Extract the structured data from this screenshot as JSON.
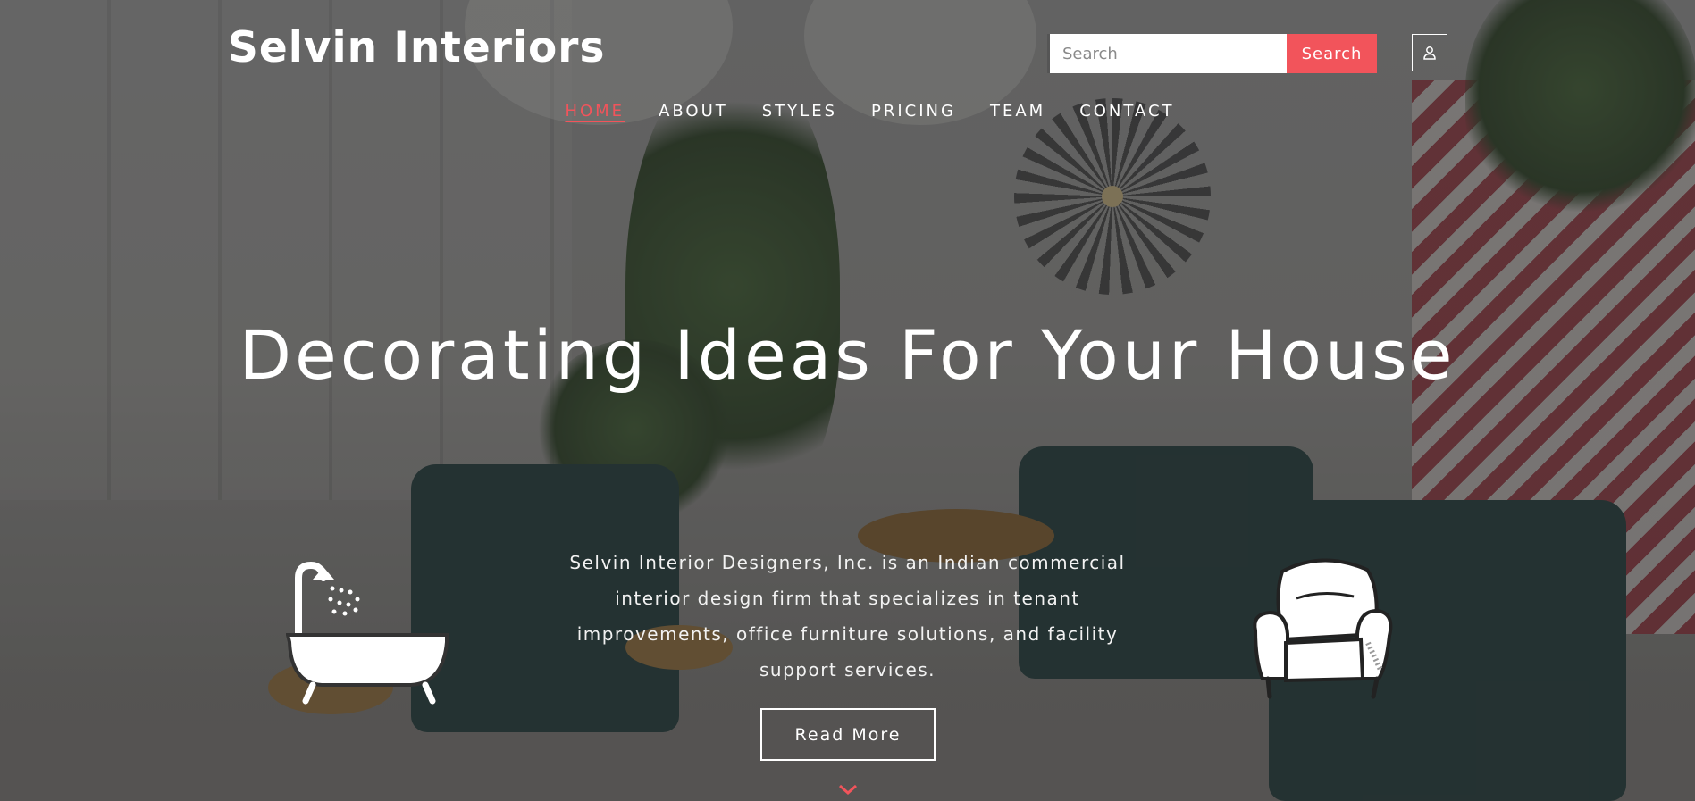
{
  "header": {
    "brand": "Selvin Interiors",
    "search": {
      "placeholder": "Search",
      "button_label": "Search"
    },
    "user_icon": "user-icon"
  },
  "nav": {
    "items": [
      {
        "label": "HOME",
        "active": true
      },
      {
        "label": "ABOUT",
        "active": false
      },
      {
        "label": "STYLES",
        "active": false
      },
      {
        "label": "PRICING",
        "active": false
      },
      {
        "label": "TEAM",
        "active": false
      },
      {
        "label": "CONTACT",
        "active": false
      }
    ]
  },
  "hero": {
    "title": "Decorating Ideas For Your House",
    "description": "Selvin Interior Designers, Inc. is an Indian commercial interior design firm that specializes in tenant improvements, office furniture solutions, and facility support services.",
    "cta_label": "Read More",
    "icons": [
      "bathtub-icon",
      "armchair-icon",
      "chevron-down-icon"
    ]
  },
  "colors": {
    "accent": "#f2545b",
    "text": "#ffffff",
    "overlay": "rgba(40,40,42,0.42)"
  }
}
